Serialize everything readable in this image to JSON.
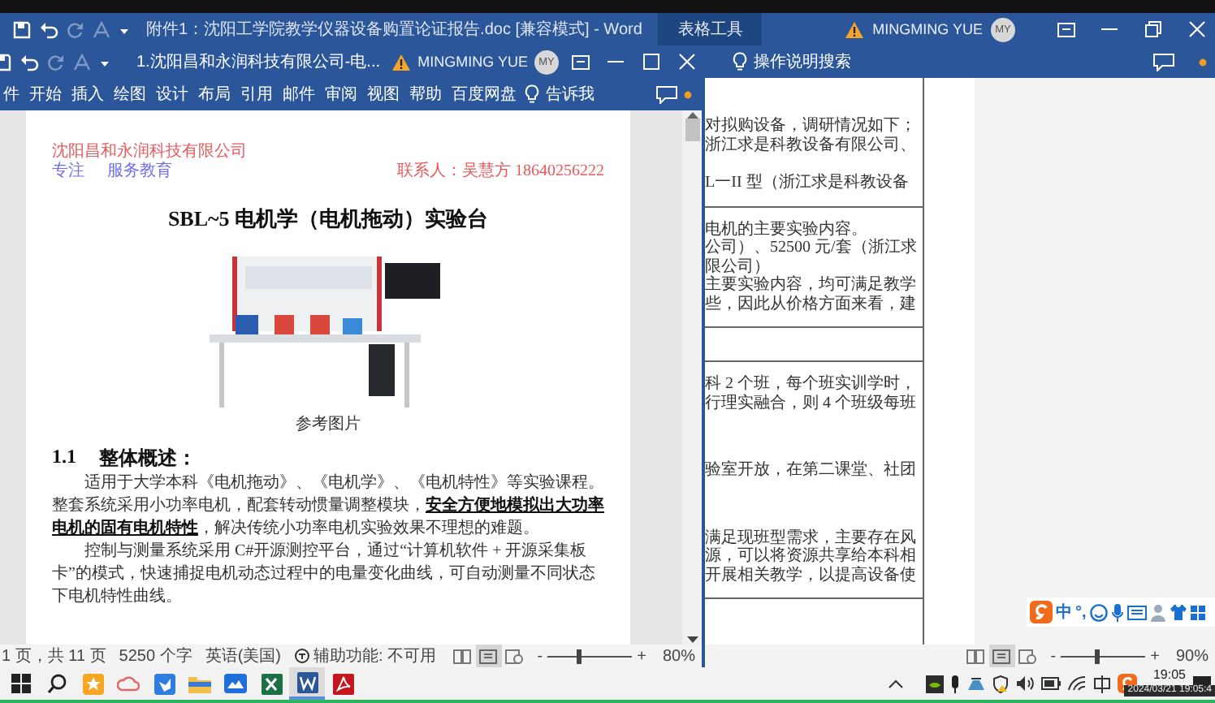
{
  "back_window": {
    "title": "附件1：沈阳工学院教学仪器设备购置论证报告.doc [兼容模式] - Word",
    "context_tab": "表格工具",
    "user": "MINGMING YUE",
    "avatar": "MY",
    "tell_me": "操作说明搜索",
    "table_cells": [
      {
        "paragraphs": [
          [
            "对拟购设备，调研情况如下；",
            "浙江求是科教设备有限公司、"
          ],
          [
            "L一II 型（浙江求是科教设备"
          ]
        ]
      },
      {
        "paragraphs": [
          [
            "电机的主要实验内容。",
            "公司）、52500 元/套（浙江求",
            "限公司）",
            "主要实验内容，均可满足教学",
            "些，因此从价格方面来看，建"
          ]
        ]
      },
      {
        "paragraphs": [
          [
            "科 2 个班，每个班实训学时，",
            "行理实融合，则 4 个班级每班"
          ],
          [
            "验室开放，在第二课堂、社团"
          ],
          [
            "满足现班型需求，主要存在风",
            "源，可以将资源共享给本科相",
            "开展相关教学，以提高设备使"
          ]
        ]
      }
    ],
    "status_bar": {
      "views": [
        {
          "selected": false
        },
        {
          "selected": true
        },
        {
          "selected": false
        }
      ],
      "zoom_out": "-",
      "zoom_in": "+",
      "zoom": {
        "level": 0.43
      },
      "zoom_text": "90%"
    }
  },
  "front_window": {
    "title": "1.沈阳昌和永润科技有限公司-电...",
    "user": "MINGMING YUE",
    "avatar": "MY",
    "tabs": [
      {
        "label": "件",
        "selected": false
      },
      {
        "label": "开始",
        "selected": false
      },
      {
        "label": "插入",
        "selected": false
      },
      {
        "label": "绘图",
        "selected": false
      },
      {
        "label": "设计",
        "selected": false
      },
      {
        "label": "布局",
        "selected": false
      },
      {
        "label": "引用",
        "selected": false
      },
      {
        "label": "邮件",
        "selected": false
      },
      {
        "label": "审阅",
        "selected": false
      },
      {
        "label": "视图",
        "selected": false
      },
      {
        "label": "帮助",
        "selected": false
      },
      {
        "label": "百度网盘",
        "selected": false
      }
    ],
    "tell_me": "告诉我",
    "document": {
      "company": "沈阳昌和永润科技有限公司",
      "slogan_1": "专注",
      "slogan_2": "服务教育",
      "contact": "联系人：吴慧方 18640256222",
      "title": "SBL~5 电机学（电机拖动）实验台",
      "caption": "参考图片",
      "heading_number": "1.1",
      "heading": "整体概述：",
      "paragraphs": [
        "适用于大学本科《电机拖动》、《电机学》、《电机特性》等实验课程。整套系统采用小功率电机，配套转动惯量调整模块，**安全方便地模拟出大功率电机的固有电机特性**，解决传统小功率电机实验效果不理想的难题。",
        "控制与测量系统采用 C#开源测控平台，通过“计算机软件 + 开源采集板卡”的模式，快速捕捉电机动态过程中的电量变化曲线，可自动测量不同状态下电机特性曲线。"
      ]
    },
    "status_bar": {
      "page": "1 页，共 11 页",
      "words": "5250 个字",
      "language": "英语(美国)",
      "accessibility": "辅助功能: 不可用",
      "views": [
        {
          "selected": false
        },
        {
          "selected": true
        },
        {
          "selected": false
        }
      ],
      "zoom_out": "-",
      "zoom_in": "+",
      "zoom": {
        "level": 0.38
      },
      "zoom_text": "80%"
    }
  },
  "ime_bar": {
    "mode": "中",
    "punctuation": "°,"
  },
  "taskbar": {
    "apps": [
      {
        "selected": false
      },
      {
        "selected": false
      },
      {
        "selected": false
      },
      {
        "selected": false
      },
      {
        "selected": false
      },
      {
        "selected": false
      },
      {
        "selected": false
      },
      {
        "selected": false
      },
      {
        "selected": true
      },
      {
        "selected": false
      }
    ],
    "time": "19:05",
    "tooltip": "2024/03/21 19:05:4"
  }
}
